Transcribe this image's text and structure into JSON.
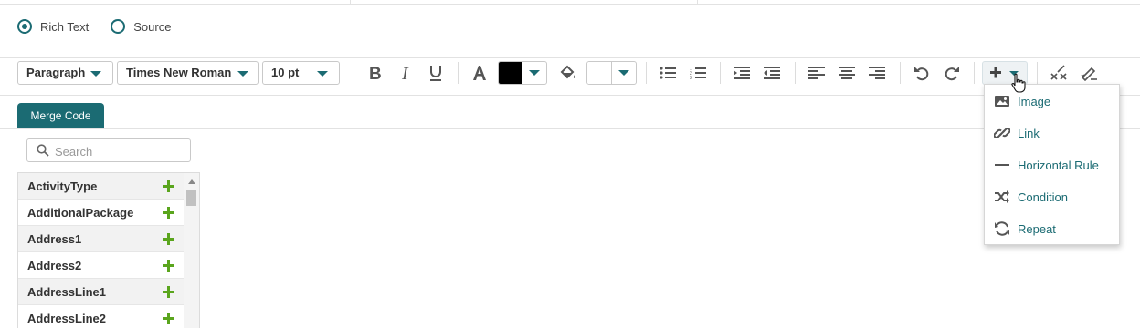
{
  "editor_mode": {
    "options": [
      {
        "label": "Rich Text",
        "selected": true
      },
      {
        "label": "Source",
        "selected": false
      }
    ]
  },
  "toolbar": {
    "block_format": "Paragraph",
    "font_family": "Times New Roman",
    "font_size": "10 pt",
    "font_color": "#000000",
    "background_color": "#ffffff",
    "icons": [
      "bold-icon",
      "italic-icon",
      "underline-icon",
      "font-color-icon",
      "paint-bucket-icon",
      "bullet-list-icon",
      "numbered-list-icon",
      "indent-icon",
      "outdent-icon",
      "align-left-icon",
      "align-center-icon",
      "align-right-icon",
      "undo-icon",
      "redo-icon",
      "insert-plus-icon",
      "remove-format-icon",
      "clear-format-icon"
    ]
  },
  "tabs": {
    "merge_code": "Merge Code"
  },
  "search": {
    "placeholder": "Search",
    "value": ""
  },
  "merge_fields": [
    "ActivityType",
    "AdditionalPackage",
    "Address1",
    "Address2",
    "AddressLine1",
    "AddressLine2"
  ],
  "insert_menu": {
    "items": [
      {
        "label": "Image",
        "icon": "image-icon"
      },
      {
        "label": "Link",
        "icon": "link-icon"
      },
      {
        "label": "Horizontal Rule",
        "icon": "horizontal-rule-icon"
      },
      {
        "label": "Condition",
        "icon": "shuffle-icon"
      },
      {
        "label": "Repeat",
        "icon": "repeat-icon"
      }
    ]
  },
  "colors": {
    "accent": "#1b6b73",
    "add_green": "#5aa51d"
  }
}
